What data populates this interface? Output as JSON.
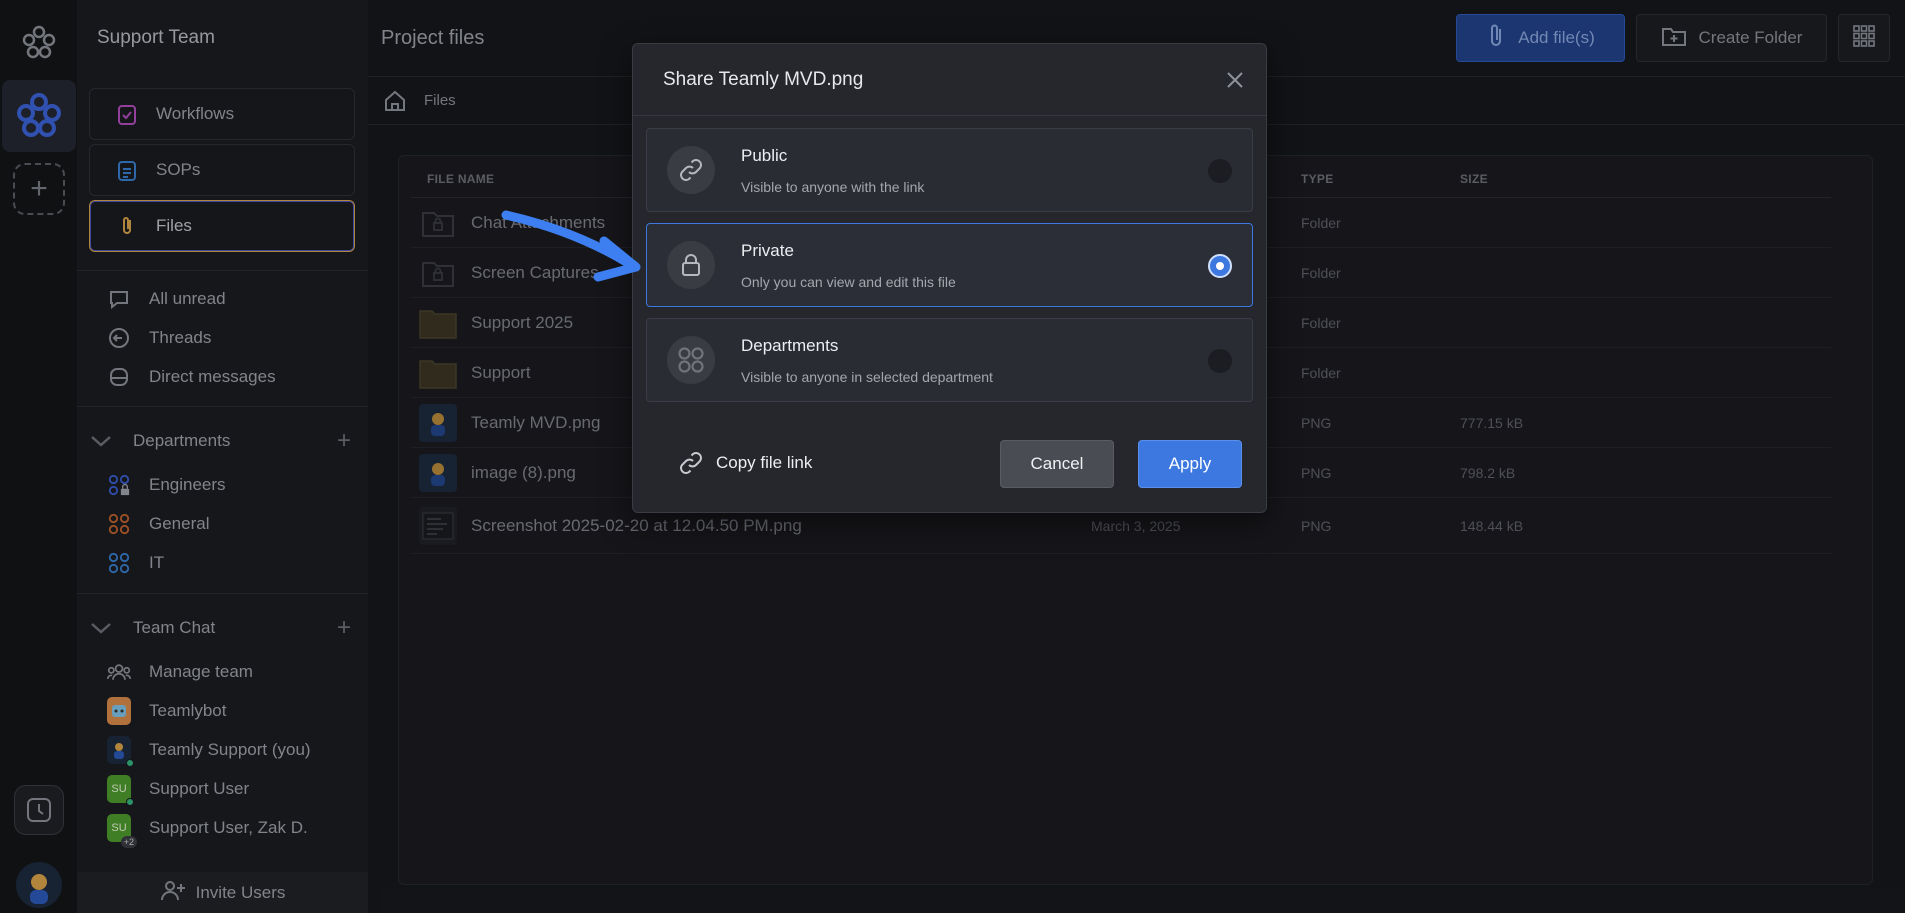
{
  "sidebar": {
    "team_name": "Support Team",
    "nav": [
      {
        "label": "Workflows",
        "icon": "clipboard-check-icon"
      },
      {
        "label": "SOPs",
        "icon": "clipboard-list-icon"
      },
      {
        "label": "Files",
        "icon": "paperclip-icon"
      }
    ],
    "inbox": [
      {
        "label": "All unread",
        "icon": "chat-bubble-icon"
      },
      {
        "label": "Threads",
        "icon": "thread-icon"
      },
      {
        "label": "Direct messages",
        "icon": "inbox-icon"
      }
    ],
    "departments": {
      "heading": "Departments",
      "items": [
        {
          "label": "Engineers",
          "color": "#3a5fd0"
        },
        {
          "label": "General",
          "color": "#c0632d"
        },
        {
          "label": "IT",
          "color": "#3a7fd0"
        }
      ]
    },
    "team_chat": {
      "heading": "Team Chat",
      "items": [
        {
          "label": "Manage team"
        },
        {
          "label": "Teamlybot"
        },
        {
          "label": "Teamly Support (you)"
        },
        {
          "label": "Support User",
          "initials": "SU"
        },
        {
          "label": "Support User, Zak D.",
          "initials": "SU",
          "extra": "+2"
        }
      ]
    },
    "invite_label": "Invite Users"
  },
  "header": {
    "title": "Project files",
    "add_files_label": "Add file(s)",
    "create_folder_label": "Create Folder"
  },
  "breadcrumb": {
    "label": "Files"
  },
  "table": {
    "columns": [
      "FILE NAME",
      "TYPE",
      "SIZE"
    ],
    "rows": [
      {
        "name": "Chat Attachments",
        "date": "",
        "type": "Folder",
        "size": "",
        "kind": "locked-folder"
      },
      {
        "name": "Screen Captures",
        "date": "",
        "type": "Folder",
        "size": "",
        "kind": "locked-folder"
      },
      {
        "name": "Support 2025",
        "date": "",
        "type": "Folder",
        "size": "",
        "kind": "folder"
      },
      {
        "name": "Support",
        "date": "",
        "type": "Folder",
        "size": "",
        "kind": "folder"
      },
      {
        "name": "Teamly MVD.png",
        "date": "",
        "type": "PNG",
        "size": "777.15 kB",
        "kind": "image"
      },
      {
        "name": "image (8).png",
        "date": "",
        "type": "PNG",
        "size": "798.2 kB",
        "kind": "image"
      },
      {
        "name": "Screenshot 2025-02-20 at 12.04.50 PM.png",
        "date": "March 3, 2025",
        "type": "PNG",
        "size": "148.44 kB",
        "kind": "screenshot"
      }
    ]
  },
  "modal": {
    "title": "Share Teamly MVD.png",
    "options": [
      {
        "label": "Public",
        "desc": "Visible to anyone with the link",
        "icon": "link-icon",
        "selected": false
      },
      {
        "label": "Private",
        "desc": "Only you can view and edit this file",
        "icon": "lock-icon",
        "selected": true
      },
      {
        "label": "Departments",
        "desc": "Visible to anyone in selected department",
        "icon": "departments-icon",
        "selected": false
      }
    ],
    "copy_link_label": "Copy file link",
    "cancel_label": "Cancel",
    "apply_label": "Apply"
  },
  "colors": {
    "accent": "#3c78e0",
    "selected_border": "#d8a34a",
    "annotation_arrow": "#3d7ff0"
  }
}
